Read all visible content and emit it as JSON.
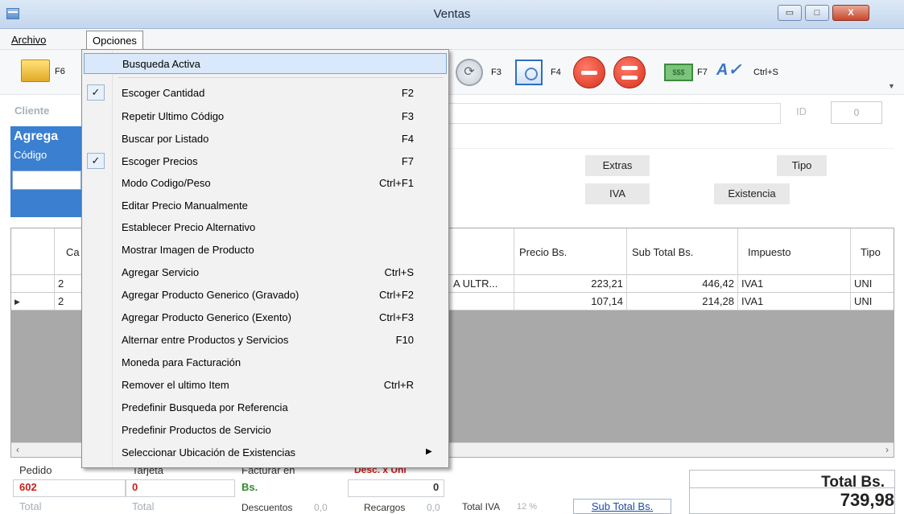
{
  "window": {
    "title": "Ventas",
    "min_label": "▭",
    "max_label": "□",
    "close_label": "X"
  },
  "menubar": {
    "archivo": "Archivo",
    "opciones": "Opciones"
  },
  "toolbar": {
    "f6": "F6",
    "f3": "F3",
    "f4": "F4",
    "f7": "F7",
    "ctrl_s": "Ctrl+S",
    "money": "$$$"
  },
  "cliente": {
    "label": "Cliente",
    "id_label": "ID",
    "id_value": "0"
  },
  "agrega": {
    "title": "Agrega",
    "codigo": "Código"
  },
  "info": {
    "extras": "Extras",
    "tipo": "Tipo",
    "iva": "IVA",
    "existencia": "Existencia"
  },
  "grid": {
    "headers": {
      "cant": "Ca",
      "precio": "Precio Bs.",
      "subtotal": "Sub Total Bs.",
      "impuesto": "Impuesto",
      "tipo": "Tipo"
    },
    "rows": [
      {
        "cant": "2",
        "desc": "A ULTR...",
        "precio": "223,21",
        "subtotal": "446,42",
        "impuesto": "IVA1",
        "tipo": "UNI"
      },
      {
        "cant": "2",
        "desc": "",
        "precio": "107,14",
        "subtotal": "214,28",
        "impuesto": "IVA1",
        "tipo": "UNI"
      }
    ]
  },
  "bottom": {
    "pedido_label": "Pedido",
    "pedido_value": "602",
    "tarjeta_label": "Tarjeta",
    "tarjeta_value": "0",
    "facturar_label": "Facturar en",
    "facturar_value": "Bs.",
    "desc_label": "Desc. x Uni",
    "desc_value": "0",
    "total_label_1": "Total",
    "total_label_2": "Total",
    "descuentos_label": "Descuentos",
    "descuentos_value": "0,0",
    "recargos_label": "Recargos",
    "recargos_value": "0,0",
    "total_iva_label": "Total IVA",
    "total_iva_value": "12 %",
    "subtotal_btn": "Sub Total Bs.",
    "total_bs_label": "Total Bs.",
    "total_bs_value": "739,98"
  },
  "dropdown": {
    "items": [
      {
        "label": "Busqueda Activa",
        "shortcut": "",
        "checked": false
      },
      {
        "label": "Escoger Cantidad",
        "shortcut": "F2",
        "checked": true
      },
      {
        "label": "Repetir Ultimo Código",
        "shortcut": "F3",
        "checked": false
      },
      {
        "label": "Buscar por Listado",
        "shortcut": "F4",
        "checked": false
      },
      {
        "label": "Escoger Precios",
        "shortcut": "F7",
        "checked": true
      },
      {
        "label": "Modo Codigo/Peso",
        "shortcut": "Ctrl+F1",
        "checked": false
      },
      {
        "label": "Editar Precio Manualmente",
        "shortcut": "",
        "checked": false
      },
      {
        "label": "Establecer Precio Alternativo",
        "shortcut": "",
        "checked": false
      },
      {
        "label": "Mostrar Imagen de Producto",
        "shortcut": "",
        "checked": false
      },
      {
        "label": "Agregar Servicio",
        "shortcut": "Ctrl+S",
        "checked": false
      },
      {
        "label": "Agregar Producto Generico (Gravado)",
        "shortcut": "Ctrl+F2",
        "checked": false
      },
      {
        "label": "Agregar Producto Generico (Exento)",
        "shortcut": "Ctrl+F3",
        "checked": false
      },
      {
        "label": "Alternar entre  Productos y Servicios",
        "shortcut": "F10",
        "checked": false
      },
      {
        "label": "Moneda para Facturación",
        "shortcut": "",
        "checked": false
      },
      {
        "label": "Remover el ultimo Item",
        "shortcut": "Ctrl+R",
        "checked": false
      },
      {
        "label": "Predefinir Busqueda por Referencia",
        "shortcut": "",
        "checked": false
      },
      {
        "label": "Predefinir Productos de Servicio",
        "shortcut": "",
        "checked": false
      },
      {
        "label": "Seleccionar Ubicación de Existencias",
        "shortcut": "",
        "checked": false
      }
    ],
    "check_glyph": "✓",
    "submenu_arrow": "▶"
  }
}
